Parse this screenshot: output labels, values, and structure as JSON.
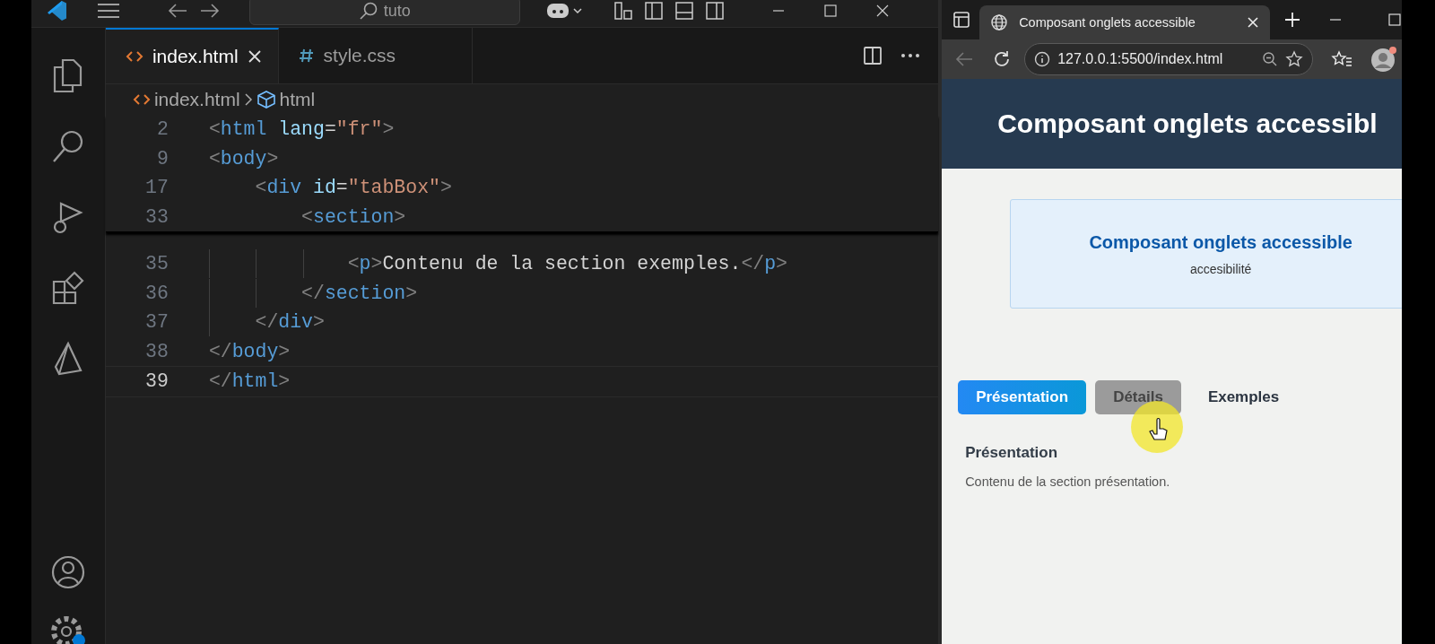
{
  "title_bar": {
    "search": "tuto"
  },
  "editor_tabs": [
    {
      "label": "index.html",
      "kind": "html",
      "selected": true
    },
    {
      "label": "style.css",
      "kind": "css",
      "selected": false
    }
  ],
  "breadcrumb": [
    {
      "label": "index.html",
      "kind": "html"
    },
    {
      "label": "html",
      "kind": "element"
    }
  ],
  "sticky_lines": [
    {
      "number": "2",
      "tokens": [
        {
          "kind": "punct",
          "text": "<"
        },
        {
          "kind": "tag",
          "text": "html"
        },
        {
          "kind": "attr",
          "text": " lang"
        },
        {
          "kind": "text",
          "text": "="
        },
        {
          "kind": "string",
          "text": "\"fr\""
        },
        {
          "kind": "punct",
          "text": ">"
        }
      ]
    },
    {
      "number": "9",
      "tokens": [
        {
          "kind": "punct",
          "text": "<"
        },
        {
          "kind": "tag",
          "text": "body"
        },
        {
          "kind": "punct",
          "text": ">"
        }
      ]
    },
    {
      "number": "17",
      "tokens": [
        {
          "kind": "punct",
          "text": "    <"
        },
        {
          "kind": "tag",
          "text": "div"
        },
        {
          "kind": "attr",
          "text": " id"
        },
        {
          "kind": "text",
          "text": "="
        },
        {
          "kind": "string",
          "text": "\"tabBox\""
        },
        {
          "kind": "punct",
          "text": ">"
        }
      ]
    },
    {
      "number": "33",
      "tokens": [
        {
          "kind": "punct",
          "text": "        <"
        },
        {
          "kind": "tag",
          "text": "section"
        },
        {
          "kind": "punct",
          "text": ">"
        }
      ]
    }
  ],
  "code_lines": [
    {
      "number": "35",
      "current": false,
      "tokens": [
        {
          "kind": "punct",
          "text": "            <"
        },
        {
          "kind": "tag",
          "text": "p"
        },
        {
          "kind": "punct",
          "text": ">"
        },
        {
          "kind": "text",
          "text": "Contenu de la section exemples."
        },
        {
          "kind": "punct",
          "text": "</"
        },
        {
          "kind": "tag",
          "text": "p"
        },
        {
          "kind": "punct",
          "text": ">"
        }
      ]
    },
    {
      "number": "36",
      "current": false,
      "tokens": [
        {
          "kind": "punct",
          "text": "        </"
        },
        {
          "kind": "tag",
          "text": "section"
        },
        {
          "kind": "punct",
          "text": ">"
        }
      ]
    },
    {
      "number": "37",
      "current": false,
      "tokens": [
        {
          "kind": "punct",
          "text": "    </"
        },
        {
          "kind": "tag",
          "text": "div"
        },
        {
          "kind": "punct",
          "text": ">"
        }
      ]
    },
    {
      "number": "38",
      "current": false,
      "tokens": [
        {
          "kind": "punct",
          "text": "</"
        },
        {
          "kind": "tag",
          "text": "body"
        },
        {
          "kind": "punct",
          "text": ">"
        }
      ]
    },
    {
      "number": "39",
      "current": true,
      "tokens": [
        {
          "kind": "punct",
          "text": "</"
        },
        {
          "kind": "tag",
          "text": "html"
        },
        {
          "kind": "punct",
          "text": ">"
        }
      ]
    }
  ],
  "browser": {
    "tab_title": "Composant onglets accessible",
    "address": "127.0.0.1:5500/index.html",
    "page": {
      "header": "Composant onglets accessibl",
      "card": {
        "title": "Composant onglets accessible",
        "subtitle": "accesibilité"
      },
      "tabs": [
        {
          "label": "Présentation",
          "selected": true,
          "hovered": false
        },
        {
          "label": "Détails",
          "selected": false,
          "hovered": true
        },
        {
          "label": "Exemples",
          "selected": false,
          "hovered": false
        }
      ],
      "section": {
        "heading": "Présentation",
        "text": "Contenu de la section présentation."
      }
    }
  }
}
